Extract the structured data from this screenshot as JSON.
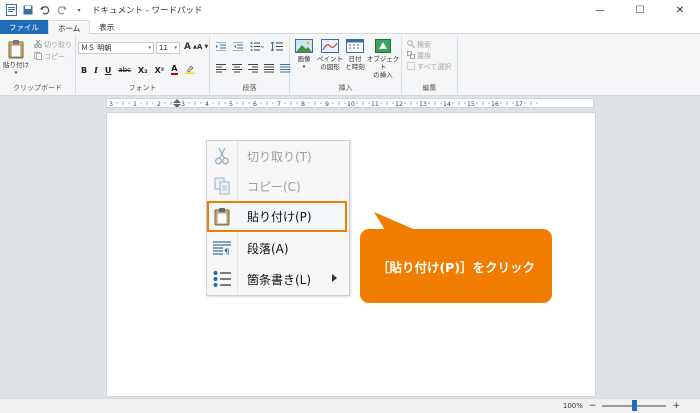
{
  "window": {
    "title": "ドキュメント - ワードパッド",
    "controls": {
      "minimize": "—",
      "maximize": "☐",
      "close": "✕"
    }
  },
  "tabs": [
    {
      "label": "ファイル"
    },
    {
      "label": "ホーム"
    },
    {
      "label": "表示"
    }
  ],
  "ribbon": {
    "clipboard": {
      "group_label": "クリップボード",
      "paste": "貼り付け",
      "cut": "切り取り",
      "copy": "コピー"
    },
    "font": {
      "group_label": "フォント",
      "font_name": "ＭＳ 明朝",
      "font_size": "11",
      "grow": "A",
      "shrink": "A",
      "bold": "B",
      "italic": "I",
      "underline": "U",
      "strike": "abc",
      "subscript": "X₂",
      "superscript": "X²",
      "color_a": "A"
    },
    "paragraph": {
      "group_label": "段落"
    },
    "insert": {
      "group_label": "挿入",
      "picture": "画像",
      "paint_l1": "ペイント",
      "paint_l2": "の図形",
      "datetime_l1": "日付",
      "datetime_l2": "と時刻",
      "object_l1": "オブジェクト",
      "object_l2": "の挿入"
    },
    "edit": {
      "group_label": "編集",
      "find": "検索",
      "replace": "置換",
      "select_all": "すべて選択"
    }
  },
  "ruler": {
    "labels": [
      "3",
      "1",
      "2",
      "3",
      "4",
      "5",
      "6",
      "7",
      "8",
      "9",
      "10",
      "11",
      "12",
      "13",
      "14",
      "15",
      "16",
      "17"
    ]
  },
  "context_menu": {
    "items": [
      {
        "label": "切り取り(T)",
        "icon": "scissors-icon",
        "enabled": false
      },
      {
        "label": "コピー(C)",
        "icon": "copy-icon",
        "enabled": false
      },
      {
        "label": "貼り付け(P)",
        "icon": "paste-icon",
        "enabled": true
      },
      {
        "label": "段落(A)",
        "icon": "paragraph-icon",
        "enabled": true
      },
      {
        "label": "箇条書き(L)",
        "icon": "bullets-icon",
        "enabled": true
      }
    ]
  },
  "callout": {
    "text": "［貼り付け(P)］をクリック"
  },
  "status": {
    "zoom": "100%",
    "zoom_minus": "−",
    "zoom_plus": "+",
    "zoom_level": 1.0
  },
  "colors": {
    "accent": "#1e6cb8",
    "highlight": "#f07d00"
  }
}
